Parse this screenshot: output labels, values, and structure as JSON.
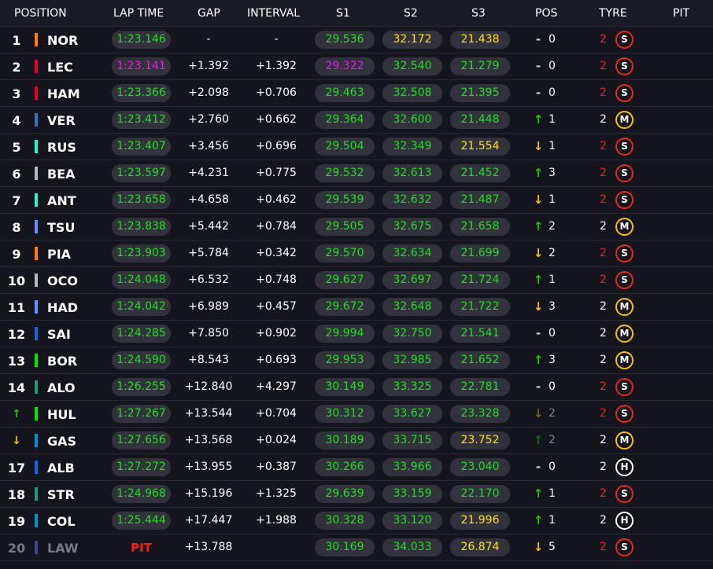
{
  "header": {
    "position": "POSITION",
    "lap_time": "LAP TIME",
    "gap": "GAP",
    "interval": "INTERVAL",
    "s1": "S1",
    "s2": "S2",
    "s3": "S3",
    "pos": "POS",
    "tyre": "TYRE",
    "pit": "PIT"
  },
  "rows": [
    {
      "position": "1",
      "driver": "NOR",
      "team_color": "#ff8000",
      "lap": "1:23.146",
      "lap_color": "green",
      "gap": "-",
      "interval": "-",
      "s1": "29.536",
      "s1_color": "green",
      "s2": "32.172",
      "s2_color": "yellow",
      "s3": "21.438",
      "s3_color": "yellow",
      "pos_icon": "same",
      "pos_change": "0",
      "tyre_age": "2",
      "tyre": "S"
    },
    {
      "position": "2",
      "driver": "LEC",
      "team_color": "#e8002d",
      "lap": "1:23.141",
      "lap_color": "purple",
      "gap": "+1.392",
      "interval": "+1.392",
      "s1": "29.322",
      "s1_color": "purple",
      "s2": "32.540",
      "s2_color": "green",
      "s3": "21.279",
      "s3_color": "green",
      "pos_icon": "same",
      "pos_change": "0",
      "tyre_age": "2",
      "tyre": "S"
    },
    {
      "position": "3",
      "driver": "HAM",
      "team_color": "#e8002d",
      "lap": "1:23.366",
      "lap_color": "green",
      "gap": "+2.098",
      "interval": "+0.706",
      "s1": "29.463",
      "s1_color": "green",
      "s2": "32.508",
      "s2_color": "green",
      "s3": "21.395",
      "s3_color": "green",
      "pos_icon": "same",
      "pos_change": "0",
      "tyre_age": "2",
      "tyre": "S"
    },
    {
      "position": "4",
      "driver": "VER",
      "team_color": "#3671c6",
      "lap": "1:23.412",
      "lap_color": "green",
      "gap": "+2.760",
      "interval": "+0.662",
      "s1": "29.364",
      "s1_color": "green",
      "s2": "32.600",
      "s2_color": "green",
      "s3": "21.448",
      "s3_color": "green",
      "pos_icon": "up",
      "pos_change": "1",
      "tyre_age": "2",
      "tyre": "M"
    },
    {
      "position": "5",
      "driver": "RUS",
      "team_color": "#27f4d2",
      "lap": "1:23.407",
      "lap_color": "green",
      "gap": "+3.456",
      "interval": "+0.696",
      "s1": "29.504",
      "s1_color": "green",
      "s2": "32.349",
      "s2_color": "green",
      "s3": "21.554",
      "s3_color": "yellow",
      "pos_icon": "down",
      "pos_change": "1",
      "tyre_age": "2",
      "tyre": "S"
    },
    {
      "position": "6",
      "driver": "BEA",
      "team_color": "#b6babd",
      "lap": "1:23.597",
      "lap_color": "green",
      "gap": "+4.231",
      "interval": "+0.775",
      "s1": "29.532",
      "s1_color": "green",
      "s2": "32.613",
      "s2_color": "green",
      "s3": "21.452",
      "s3_color": "green",
      "pos_icon": "up",
      "pos_change": "3",
      "tyre_age": "2",
      "tyre": "S"
    },
    {
      "position": "7",
      "driver": "ANT",
      "team_color": "#27f4d2",
      "lap": "1:23.658",
      "lap_color": "green",
      "gap": "+4.658",
      "interval": "+0.462",
      "s1": "29.539",
      "s1_color": "green",
      "s2": "32.632",
      "s2_color": "green",
      "s3": "21.487",
      "s3_color": "green",
      "pos_icon": "down",
      "pos_change": "1",
      "tyre_age": "2",
      "tyre": "S"
    },
    {
      "position": "8",
      "driver": "TSU",
      "team_color": "#6692ff",
      "lap": "1:23.838",
      "lap_color": "green",
      "gap": "+5.442",
      "interval": "+0.784",
      "s1": "29.505",
      "s1_color": "green",
      "s2": "32.675",
      "s2_color": "green",
      "s3": "21.658",
      "s3_color": "green",
      "pos_icon": "up",
      "pos_change": "2",
      "tyre_age": "2",
      "tyre": "M"
    },
    {
      "position": "9",
      "driver": "PIA",
      "team_color": "#ff8000",
      "lap": "1:23.903",
      "lap_color": "green",
      "gap": "+5.784",
      "interval": "+0.342",
      "s1": "29.570",
      "s1_color": "green",
      "s2": "32.634",
      "s2_color": "green",
      "s3": "21.699",
      "s3_color": "green",
      "pos_icon": "down",
      "pos_change": "2",
      "tyre_age": "2",
      "tyre": "S"
    },
    {
      "position": "10",
      "driver": "OCO",
      "team_color": "#b6babd",
      "lap": "1:24.048",
      "lap_color": "green",
      "gap": "+6.532",
      "interval": "+0.748",
      "s1": "29.627",
      "s1_color": "green",
      "s2": "32.697",
      "s2_color": "green",
      "s3": "21.724",
      "s3_color": "green",
      "pos_icon": "up",
      "pos_change": "1",
      "tyre_age": "2",
      "tyre": "S"
    },
    {
      "position": "11",
      "driver": "HAD",
      "team_color": "#6692ff",
      "lap": "1:24.042",
      "lap_color": "green",
      "gap": "+6.989",
      "interval": "+0.457",
      "s1": "29.672",
      "s1_color": "green",
      "s2": "32.648",
      "s2_color": "green",
      "s3": "21.722",
      "s3_color": "green",
      "pos_icon": "down",
      "pos_change": "3",
      "tyre_age": "2",
      "tyre": "M"
    },
    {
      "position": "12",
      "driver": "SAI",
      "team_color": "#1868db",
      "lap": "1:24.285",
      "lap_color": "green",
      "gap": "+7.850",
      "interval": "+0.902",
      "s1": "29.994",
      "s1_color": "green",
      "s2": "32.750",
      "s2_color": "green",
      "s3": "21.541",
      "s3_color": "green",
      "pos_icon": "same",
      "pos_change": "0",
      "tyre_age": "2",
      "tyre": "M"
    },
    {
      "position": "13",
      "driver": "BOR",
      "team_color": "#00e701",
      "lap": "1:24.590",
      "lap_color": "green",
      "gap": "+8.543",
      "interval": "+0.693",
      "s1": "29.953",
      "s1_color": "green",
      "s2": "32.985",
      "s2_color": "green",
      "s3": "21.652",
      "s3_color": "green",
      "pos_icon": "up",
      "pos_change": "3",
      "tyre_age": "2",
      "tyre": "M"
    },
    {
      "position": "14",
      "driver": "ALO",
      "team_color": "#229971",
      "lap": "1:26.255",
      "lap_color": "green",
      "gap": "+12.840",
      "interval": "+4.297",
      "s1": "30.149",
      "s1_color": "green",
      "s2": "33.325",
      "s2_color": "green",
      "s3": "22.781",
      "s3_color": "green",
      "pos_icon": "same",
      "pos_change": "0",
      "tyre_age": "2",
      "tyre": "S"
    },
    {
      "position": "↑",
      "driver": "HUL",
      "team_color": "#00e701",
      "lap": "1:27.267",
      "lap_color": "green",
      "gap": "+13.544",
      "interval": "+0.704",
      "s1": "30.312",
      "s1_color": "green",
      "s2": "33.627",
      "s2_color": "green",
      "s3": "23.328",
      "s3_color": "green",
      "pos_icon": "down",
      "pos_change": "2",
      "change_dim": true,
      "tyre_age": "2",
      "tyre": "S"
    },
    {
      "position": "↓",
      "driver": "GAS",
      "team_color": "#0093cc",
      "lap": "1:27.656",
      "lap_color": "green",
      "gap": "+13.568",
      "interval": "+0.024",
      "s1": "30.189",
      "s1_color": "green",
      "s2": "33.715",
      "s2_color": "green",
      "s3": "23.752",
      "s3_color": "yellow",
      "pos_icon": "up",
      "pos_change": "2",
      "change_dim": true,
      "tyre_age": "2",
      "tyre": "M"
    },
    {
      "position": "17",
      "driver": "ALB",
      "team_color": "#1868db",
      "lap": "1:27.272",
      "lap_color": "green",
      "gap": "+13.955",
      "interval": "+0.387",
      "s1": "30.266",
      "s1_color": "green",
      "s2": "33.966",
      "s2_color": "green",
      "s3": "23.040",
      "s3_color": "green",
      "pos_icon": "same",
      "pos_change": "0",
      "tyre_age": "2",
      "tyre": "H"
    },
    {
      "position": "18",
      "driver": "STR",
      "team_color": "#229971",
      "lap": "1:24.968",
      "lap_color": "green",
      "gap": "+15.196",
      "interval": "+1.325",
      "s1": "29.639",
      "s1_color": "green",
      "s2": "33.159",
      "s2_color": "green",
      "s3": "22.170",
      "s3_color": "green",
      "pos_icon": "up",
      "pos_change": "1",
      "tyre_age": "2",
      "tyre": "S"
    },
    {
      "position": "19",
      "driver": "COL",
      "team_color": "#0093cc",
      "lap": "1:25.444",
      "lap_color": "green",
      "gap": "+17.447",
      "interval": "+1.988",
      "s1": "30.328",
      "s1_color": "green",
      "s2": "33.120",
      "s2_color": "green",
      "s3": "21.996",
      "s3_color": "yellow",
      "pos_icon": "up",
      "pos_change": "1",
      "tyre_age": "2",
      "tyre": "H"
    },
    {
      "position": "20",
      "driver": "LAW",
      "team_color": "#3c4a8c",
      "lap": "PIT",
      "lap_color": "pit",
      "gap": "+13.788",
      "interval": "",
      "s1": "30.169",
      "s1_color": "green",
      "s2": "34.033",
      "s2_color": "green",
      "s3": "26.874",
      "s3_color": "yellow",
      "pos_icon": "down",
      "pos_change": "5",
      "tyre_age": "2",
      "tyre": "S",
      "muted": true
    }
  ],
  "colors": {
    "background": "#15151e",
    "pill": "#32323c",
    "green": "#1fe01f",
    "yellow": "#ffe11a",
    "purple": "#e51ee5",
    "pit": "#ff1a1a",
    "soft": "#e8281e",
    "medium": "#f5c400",
    "hard": "#ffffff"
  }
}
